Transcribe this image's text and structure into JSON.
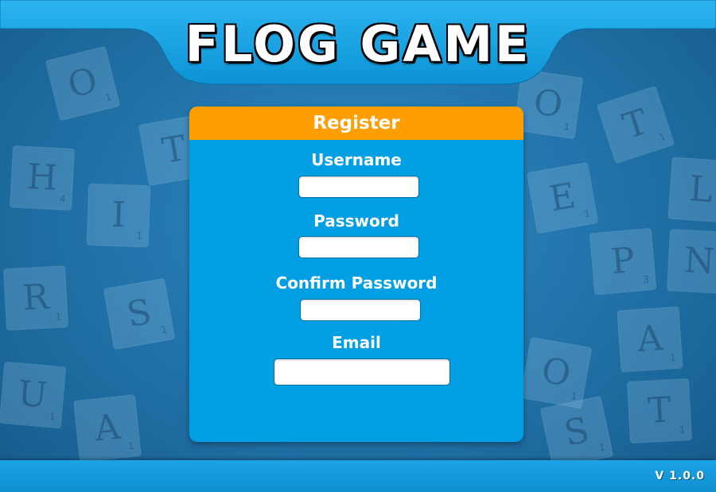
{
  "game": {
    "title": "FLOG GAME",
    "version": "V 1.0.0"
  },
  "register_form": {
    "heading": "Register",
    "fields": [
      {
        "label": "Username",
        "value": ""
      },
      {
        "label": "Password",
        "value": ""
      },
      {
        "label": "Confirm Password",
        "value": ""
      },
      {
        "label": "Email",
        "value": ""
      }
    ]
  },
  "background_tiles": [
    {
      "letter": "O",
      "number": "1"
    },
    {
      "letter": "T",
      "number": "1"
    },
    {
      "letter": "H",
      "number": "4"
    },
    {
      "letter": "I",
      "number": "1"
    },
    {
      "letter": "R",
      "number": "1"
    },
    {
      "letter": "S",
      "number": "1"
    },
    {
      "letter": "U",
      "number": "1"
    },
    {
      "letter": "A",
      "number": "1"
    },
    {
      "letter": "O",
      "number": "1"
    },
    {
      "letter": "T",
      "number": "1"
    },
    {
      "letter": "E",
      "number": "1"
    },
    {
      "letter": "L",
      "number": "1"
    },
    {
      "letter": "P",
      "number": "3"
    },
    {
      "letter": "N",
      "number": "1"
    },
    {
      "letter": "A",
      "number": "1"
    },
    {
      "letter": "O",
      "number": "1"
    },
    {
      "letter": "T",
      "number": "1"
    },
    {
      "letter": "S",
      "number": "1"
    }
  ],
  "colors": {
    "header_bar": "#1ba3e6",
    "panel_body": "#009fe3",
    "panel_header": "#ff9e00",
    "footer_bar": "#1ba3e6"
  }
}
